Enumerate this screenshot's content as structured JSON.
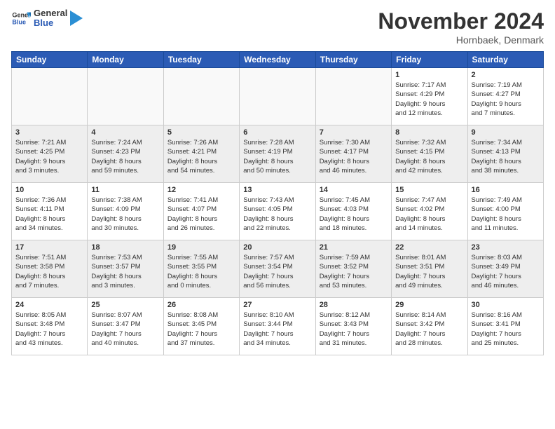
{
  "logo": {
    "text_general": "General",
    "text_blue": "Blue"
  },
  "title": "November 2024",
  "location": "Hornbaek, Denmark",
  "days_header": [
    "Sunday",
    "Monday",
    "Tuesday",
    "Wednesday",
    "Thursday",
    "Friday",
    "Saturday"
  ],
  "weeks": [
    [
      {
        "day": "",
        "info": ""
      },
      {
        "day": "",
        "info": ""
      },
      {
        "day": "",
        "info": ""
      },
      {
        "day": "",
        "info": ""
      },
      {
        "day": "",
        "info": ""
      },
      {
        "day": "1",
        "info": "Sunrise: 7:17 AM\nSunset: 4:29 PM\nDaylight: 9 hours\nand 12 minutes."
      },
      {
        "day": "2",
        "info": "Sunrise: 7:19 AM\nSunset: 4:27 PM\nDaylight: 9 hours\nand 7 minutes."
      }
    ],
    [
      {
        "day": "3",
        "info": "Sunrise: 7:21 AM\nSunset: 4:25 PM\nDaylight: 9 hours\nand 3 minutes."
      },
      {
        "day": "4",
        "info": "Sunrise: 7:24 AM\nSunset: 4:23 PM\nDaylight: 8 hours\nand 59 minutes."
      },
      {
        "day": "5",
        "info": "Sunrise: 7:26 AM\nSunset: 4:21 PM\nDaylight: 8 hours\nand 54 minutes."
      },
      {
        "day": "6",
        "info": "Sunrise: 7:28 AM\nSunset: 4:19 PM\nDaylight: 8 hours\nand 50 minutes."
      },
      {
        "day": "7",
        "info": "Sunrise: 7:30 AM\nSunset: 4:17 PM\nDaylight: 8 hours\nand 46 minutes."
      },
      {
        "day": "8",
        "info": "Sunrise: 7:32 AM\nSunset: 4:15 PM\nDaylight: 8 hours\nand 42 minutes."
      },
      {
        "day": "9",
        "info": "Sunrise: 7:34 AM\nSunset: 4:13 PM\nDaylight: 8 hours\nand 38 minutes."
      }
    ],
    [
      {
        "day": "10",
        "info": "Sunrise: 7:36 AM\nSunset: 4:11 PM\nDaylight: 8 hours\nand 34 minutes."
      },
      {
        "day": "11",
        "info": "Sunrise: 7:38 AM\nSunset: 4:09 PM\nDaylight: 8 hours\nand 30 minutes."
      },
      {
        "day": "12",
        "info": "Sunrise: 7:41 AM\nSunset: 4:07 PM\nDaylight: 8 hours\nand 26 minutes."
      },
      {
        "day": "13",
        "info": "Sunrise: 7:43 AM\nSunset: 4:05 PM\nDaylight: 8 hours\nand 22 minutes."
      },
      {
        "day": "14",
        "info": "Sunrise: 7:45 AM\nSunset: 4:03 PM\nDaylight: 8 hours\nand 18 minutes."
      },
      {
        "day": "15",
        "info": "Sunrise: 7:47 AM\nSunset: 4:02 PM\nDaylight: 8 hours\nand 14 minutes."
      },
      {
        "day": "16",
        "info": "Sunrise: 7:49 AM\nSunset: 4:00 PM\nDaylight: 8 hours\nand 11 minutes."
      }
    ],
    [
      {
        "day": "17",
        "info": "Sunrise: 7:51 AM\nSunset: 3:58 PM\nDaylight: 8 hours\nand 7 minutes."
      },
      {
        "day": "18",
        "info": "Sunrise: 7:53 AM\nSunset: 3:57 PM\nDaylight: 8 hours\nand 3 minutes."
      },
      {
        "day": "19",
        "info": "Sunrise: 7:55 AM\nSunset: 3:55 PM\nDaylight: 8 hours\nand 0 minutes."
      },
      {
        "day": "20",
        "info": "Sunrise: 7:57 AM\nSunset: 3:54 PM\nDaylight: 7 hours\nand 56 minutes."
      },
      {
        "day": "21",
        "info": "Sunrise: 7:59 AM\nSunset: 3:52 PM\nDaylight: 7 hours\nand 53 minutes."
      },
      {
        "day": "22",
        "info": "Sunrise: 8:01 AM\nSunset: 3:51 PM\nDaylight: 7 hours\nand 49 minutes."
      },
      {
        "day": "23",
        "info": "Sunrise: 8:03 AM\nSunset: 3:49 PM\nDaylight: 7 hours\nand 46 minutes."
      }
    ],
    [
      {
        "day": "24",
        "info": "Sunrise: 8:05 AM\nSunset: 3:48 PM\nDaylight: 7 hours\nand 43 minutes."
      },
      {
        "day": "25",
        "info": "Sunrise: 8:07 AM\nSunset: 3:47 PM\nDaylight: 7 hours\nand 40 minutes."
      },
      {
        "day": "26",
        "info": "Sunrise: 8:08 AM\nSunset: 3:45 PM\nDaylight: 7 hours\nand 37 minutes."
      },
      {
        "day": "27",
        "info": "Sunrise: 8:10 AM\nSunset: 3:44 PM\nDaylight: 7 hours\nand 34 minutes."
      },
      {
        "day": "28",
        "info": "Sunrise: 8:12 AM\nSunset: 3:43 PM\nDaylight: 7 hours\nand 31 minutes."
      },
      {
        "day": "29",
        "info": "Sunrise: 8:14 AM\nSunset: 3:42 PM\nDaylight: 7 hours\nand 28 minutes."
      },
      {
        "day": "30",
        "info": "Sunrise: 8:16 AM\nSunset: 3:41 PM\nDaylight: 7 hours\nand 25 minutes."
      }
    ]
  ]
}
